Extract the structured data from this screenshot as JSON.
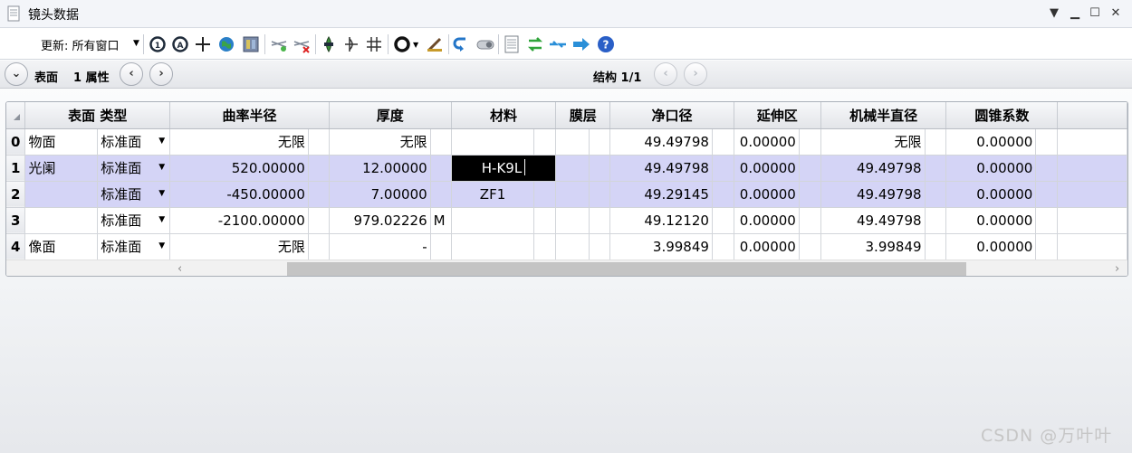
{
  "window": {
    "title": "镜头数据"
  },
  "toolbar": {
    "update_label": "更新: 所有窗口",
    "icons": [
      "refresh-icon",
      "auto-update-icon",
      "crosshair-icon",
      "globe-icon",
      "layout-icon",
      "ray-aiming-icon",
      "ray-delete-icon",
      "lens-icon",
      "lens-tilt-icon",
      "lens-split-icon",
      "aperture-icon",
      "paint-icon",
      "undo-icon",
      "toggle-icon",
      "document-icon",
      "swap-icon",
      "merge-icon",
      "arrow-right-icon",
      "help-icon"
    ]
  },
  "nav": {
    "surface_label": "表面",
    "property_label": "1 属性",
    "config_label": "结构 1/1"
  },
  "table": {
    "headers": {
      "surface_type": "表面 类型",
      "radius": "曲率半径",
      "thickness": "厚度",
      "material": "材料",
      "coating": "膜层",
      "clear_semi_dia": "净口径",
      "chip_zone": "延伸区",
      "mech_semi_dia": "机械半直径",
      "conic": "圆锥系数"
    },
    "rows": [
      {
        "num": "0",
        "comment": "物面",
        "type": "标准面",
        "radius": "无限",
        "thickness": "无限",
        "thickness_flag": "",
        "material": "",
        "coating": "",
        "clear_semi_dia": "49.49798",
        "chip_zone": "0.00000",
        "mech_semi_dia": "无限",
        "conic": "0.00000"
      },
      {
        "num": "1",
        "comment": "光阑",
        "type": "标准面",
        "radius": "520.00000",
        "thickness": "12.00000",
        "thickness_flag": "",
        "material": "H-K9L",
        "coating": "",
        "clear_semi_dia": "49.49798",
        "chip_zone": "0.00000",
        "mech_semi_dia": "49.49798",
        "conic": "0.00000"
      },
      {
        "num": "2",
        "comment": "",
        "type": "标准面",
        "radius": "-450.00000",
        "thickness": "7.00000",
        "thickness_flag": "",
        "material": "ZF1",
        "coating": "",
        "clear_semi_dia": "49.29145",
        "chip_zone": "0.00000",
        "mech_semi_dia": "49.49798",
        "conic": "0.00000"
      },
      {
        "num": "3",
        "comment": "",
        "type": "标准面",
        "radius": "-2100.00000",
        "thickness": "979.02226",
        "thickness_flag": "M",
        "material": "",
        "coating": "",
        "clear_semi_dia": "49.12120",
        "chip_zone": "0.00000",
        "mech_semi_dia": "49.49798",
        "conic": "0.00000"
      },
      {
        "num": "4",
        "comment": "像面",
        "type": "标准面",
        "radius": "无限",
        "thickness": "-",
        "thickness_flag": "",
        "material": "",
        "coating": "",
        "clear_semi_dia": "3.99849",
        "chip_zone": "0.00000",
        "mech_semi_dia": "3.99849",
        "conic": "0.00000"
      }
    ]
  },
  "watermark": "CSDN @万叶叶"
}
